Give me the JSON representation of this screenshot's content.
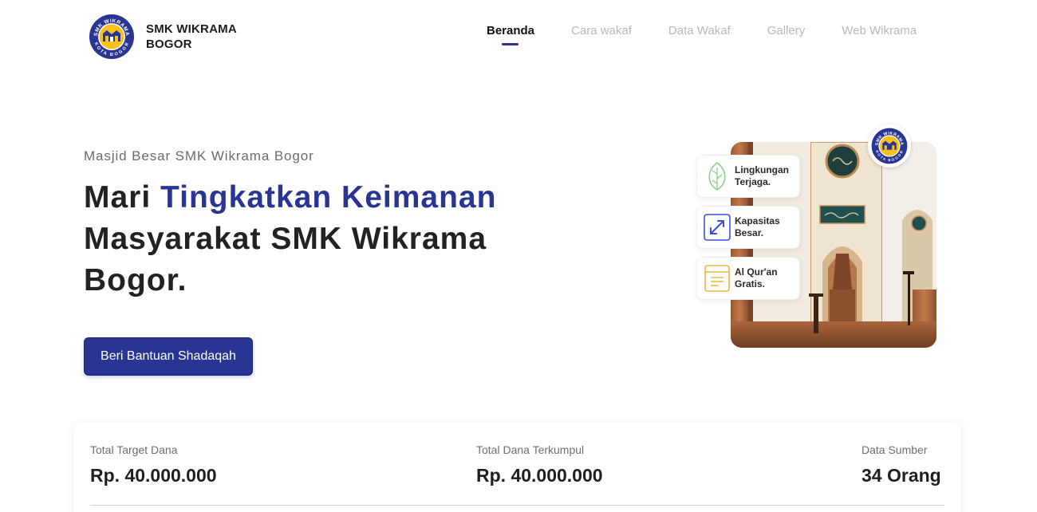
{
  "brand": {
    "line1": "SMK WIKRAMA",
    "line2": "BOGOR",
    "logo_icon": "school-logo-icon",
    "logo_text_top": "SMK WIKRAMA",
    "logo_text_bottom": "KOTA BOGOR"
  },
  "nav": {
    "items": [
      {
        "label": "Beranda",
        "active": true
      },
      {
        "label": "Cara wakaf",
        "active": false
      },
      {
        "label": "Data Wakaf",
        "active": false
      },
      {
        "label": "Gallery",
        "active": false
      },
      {
        "label": "Web Wikrama",
        "active": false
      }
    ]
  },
  "hero": {
    "eyebrow": "Masjid Besar SMK Wikrama Bogor",
    "title_part1": "Mari ",
    "title_accent": "Tingkatkan Keimanan",
    "title_part2": " Masyarakat SMK Wikrama Bogor.",
    "cta_label": "Beri Bantuan Shadaqah"
  },
  "features": [
    {
      "label": "Lingkungan Terjaga.",
      "icon": "leaf-icon",
      "color": "#8ccf8a"
    },
    {
      "label": "Kapasitas Besar.",
      "icon": "expand-arrows-icon",
      "color": "#3d4fd6"
    },
    {
      "label": "Al Qur'an Gratis.",
      "icon": "quran-book-icon",
      "color": "#f0b53a"
    }
  ],
  "stats": {
    "target": {
      "label": "Total Target Dana",
      "value": "Rp. 40.000.000"
    },
    "collected": {
      "label": "Total Dana Terkumpul",
      "value": "Rp. 40.000.000"
    },
    "donors": {
      "label": "Data Sumber",
      "value": "34 Orang"
    }
  },
  "colors": {
    "primary": "#283593",
    "nav_inactive": "#b9b9b9",
    "text_dark": "#222222"
  }
}
